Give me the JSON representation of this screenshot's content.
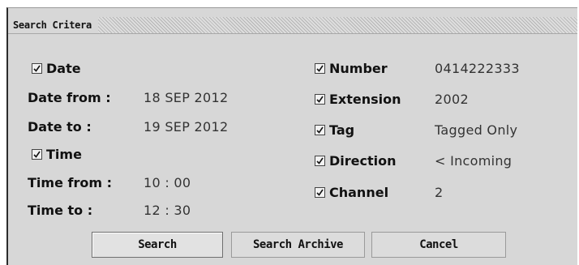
{
  "panel": {
    "title": "Search Critera"
  },
  "left": {
    "date_checkbox": {
      "label": "Date",
      "checked": true
    },
    "date_from": {
      "label": "Date from :",
      "value": "18  SEP  2012"
    },
    "date_to": {
      "label": "Date to :",
      "value": "19  SEP  2012"
    },
    "time_checkbox": {
      "label": "Time",
      "checked": true
    },
    "time_from": {
      "label": "Time from :",
      "value": "10 : 00"
    },
    "time_to": {
      "label": "Time to :",
      "value": "12 : 30"
    }
  },
  "right": {
    "number": {
      "label": "Number",
      "checked": true,
      "value": "0414222333"
    },
    "extension": {
      "label": "Extension",
      "checked": true,
      "value": "2002"
    },
    "tag": {
      "label": "Tag",
      "checked": true,
      "value": "Tagged Only"
    },
    "direction": {
      "label": "Direction",
      "checked": true,
      "value": "< Incoming"
    },
    "channel": {
      "label": "Channel",
      "checked": true,
      "value": "2"
    }
  },
  "buttons": {
    "search": "Search",
    "search_archive": "Search Archive",
    "cancel": "Cancel"
  },
  "colors": {
    "panel_bg": "#d7d7d7",
    "text": "#111111"
  }
}
